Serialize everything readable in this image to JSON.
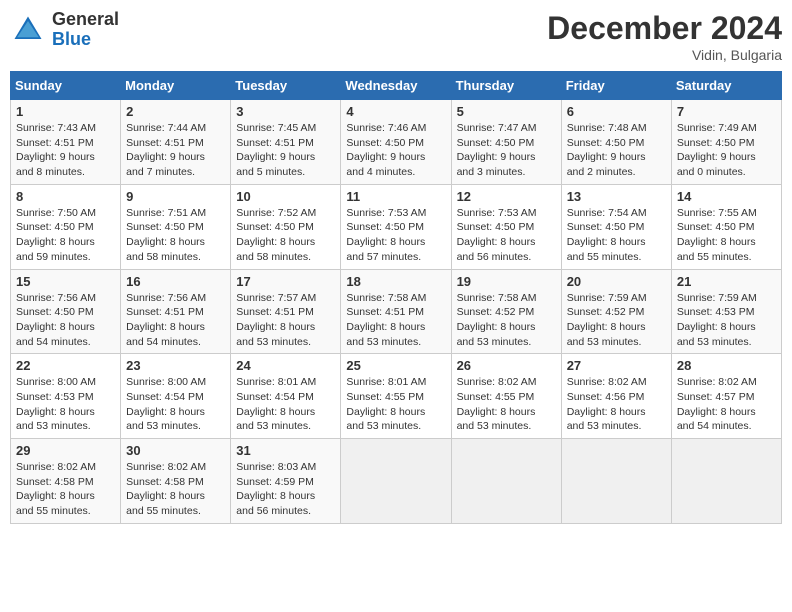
{
  "header": {
    "logo_general": "General",
    "logo_blue": "Blue",
    "month_title": "December 2024",
    "location": "Vidin, Bulgaria"
  },
  "days_of_week": [
    "Sunday",
    "Monday",
    "Tuesday",
    "Wednesday",
    "Thursday",
    "Friday",
    "Saturday"
  ],
  "weeks": [
    [
      {
        "day": "1",
        "sunrise": "7:43 AM",
        "sunset": "4:51 PM",
        "daylight": "9 hours and 8 minutes."
      },
      {
        "day": "2",
        "sunrise": "7:44 AM",
        "sunset": "4:51 PM",
        "daylight": "9 hours and 7 minutes."
      },
      {
        "day": "3",
        "sunrise": "7:45 AM",
        "sunset": "4:51 PM",
        "daylight": "9 hours and 5 minutes."
      },
      {
        "day": "4",
        "sunrise": "7:46 AM",
        "sunset": "4:50 PM",
        "daylight": "9 hours and 4 minutes."
      },
      {
        "day": "5",
        "sunrise": "7:47 AM",
        "sunset": "4:50 PM",
        "daylight": "9 hours and 3 minutes."
      },
      {
        "day": "6",
        "sunrise": "7:48 AM",
        "sunset": "4:50 PM",
        "daylight": "9 hours and 2 minutes."
      },
      {
        "day": "7",
        "sunrise": "7:49 AM",
        "sunset": "4:50 PM",
        "daylight": "9 hours and 0 minutes."
      }
    ],
    [
      {
        "day": "8",
        "sunrise": "7:50 AM",
        "sunset": "4:50 PM",
        "daylight": "8 hours and 59 minutes."
      },
      {
        "day": "9",
        "sunrise": "7:51 AM",
        "sunset": "4:50 PM",
        "daylight": "8 hours and 58 minutes."
      },
      {
        "day": "10",
        "sunrise": "7:52 AM",
        "sunset": "4:50 PM",
        "daylight": "8 hours and 58 minutes."
      },
      {
        "day": "11",
        "sunrise": "7:53 AM",
        "sunset": "4:50 PM",
        "daylight": "8 hours and 57 minutes."
      },
      {
        "day": "12",
        "sunrise": "7:53 AM",
        "sunset": "4:50 PM",
        "daylight": "8 hours and 56 minutes."
      },
      {
        "day": "13",
        "sunrise": "7:54 AM",
        "sunset": "4:50 PM",
        "daylight": "8 hours and 55 minutes."
      },
      {
        "day": "14",
        "sunrise": "7:55 AM",
        "sunset": "4:50 PM",
        "daylight": "8 hours and 55 minutes."
      }
    ],
    [
      {
        "day": "15",
        "sunrise": "7:56 AM",
        "sunset": "4:50 PM",
        "daylight": "8 hours and 54 minutes."
      },
      {
        "day": "16",
        "sunrise": "7:56 AM",
        "sunset": "4:51 PM",
        "daylight": "8 hours and 54 minutes."
      },
      {
        "day": "17",
        "sunrise": "7:57 AM",
        "sunset": "4:51 PM",
        "daylight": "8 hours and 53 minutes."
      },
      {
        "day": "18",
        "sunrise": "7:58 AM",
        "sunset": "4:51 PM",
        "daylight": "8 hours and 53 minutes."
      },
      {
        "day": "19",
        "sunrise": "7:58 AM",
        "sunset": "4:52 PM",
        "daylight": "8 hours and 53 minutes."
      },
      {
        "day": "20",
        "sunrise": "7:59 AM",
        "sunset": "4:52 PM",
        "daylight": "8 hours and 53 minutes."
      },
      {
        "day": "21",
        "sunrise": "7:59 AM",
        "sunset": "4:53 PM",
        "daylight": "8 hours and 53 minutes."
      }
    ],
    [
      {
        "day": "22",
        "sunrise": "8:00 AM",
        "sunset": "4:53 PM",
        "daylight": "8 hours and 53 minutes."
      },
      {
        "day": "23",
        "sunrise": "8:00 AM",
        "sunset": "4:54 PM",
        "daylight": "8 hours and 53 minutes."
      },
      {
        "day": "24",
        "sunrise": "8:01 AM",
        "sunset": "4:54 PM",
        "daylight": "8 hours and 53 minutes."
      },
      {
        "day": "25",
        "sunrise": "8:01 AM",
        "sunset": "4:55 PM",
        "daylight": "8 hours and 53 minutes."
      },
      {
        "day": "26",
        "sunrise": "8:02 AM",
        "sunset": "4:55 PM",
        "daylight": "8 hours and 53 minutes."
      },
      {
        "day": "27",
        "sunrise": "8:02 AM",
        "sunset": "4:56 PM",
        "daylight": "8 hours and 53 minutes."
      },
      {
        "day": "28",
        "sunrise": "8:02 AM",
        "sunset": "4:57 PM",
        "daylight": "8 hours and 54 minutes."
      }
    ],
    [
      {
        "day": "29",
        "sunrise": "8:02 AM",
        "sunset": "4:58 PM",
        "daylight": "8 hours and 55 minutes."
      },
      {
        "day": "30",
        "sunrise": "8:02 AM",
        "sunset": "4:58 PM",
        "daylight": "8 hours and 55 minutes."
      },
      {
        "day": "31",
        "sunrise": "8:03 AM",
        "sunset": "4:59 PM",
        "daylight": "8 hours and 56 minutes."
      },
      null,
      null,
      null,
      null
    ]
  ]
}
